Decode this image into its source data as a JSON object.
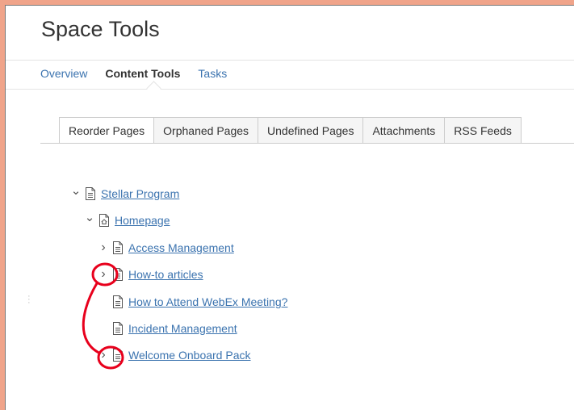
{
  "header": {
    "title": "Space Tools"
  },
  "nav": {
    "items": [
      {
        "label": "Overview",
        "active": false
      },
      {
        "label": "Content Tools",
        "active": true
      },
      {
        "label": "Tasks",
        "active": false
      }
    ]
  },
  "tabs": [
    {
      "label": "Reorder Pages",
      "active": true
    },
    {
      "label": "Orphaned Pages",
      "active": false
    },
    {
      "label": "Undefined Pages",
      "active": false
    },
    {
      "label": "Attachments",
      "active": false
    },
    {
      "label": "RSS Feeds",
      "active": false
    }
  ],
  "tree": [
    {
      "label": "Stellar Program",
      "level": 0,
      "toggle": "expanded",
      "icon": "page-icon"
    },
    {
      "label": "Homepage",
      "level": 1,
      "toggle": "expanded",
      "icon": "home-page-icon"
    },
    {
      "label": "Access Management",
      "level": 2,
      "toggle": "collapsed",
      "icon": "page-icon"
    },
    {
      "label": "How-to articles",
      "level": 2,
      "toggle": "collapsed",
      "icon": "page-icon"
    },
    {
      "label": "How to Attend WebEx Meeting?",
      "level": 2,
      "toggle": "none",
      "icon": "page-icon"
    },
    {
      "label": "Incident Management",
      "level": 2,
      "toggle": "none",
      "icon": "page-icon"
    },
    {
      "label": "Welcome Onboard Pack",
      "level": 2,
      "toggle": "collapsed",
      "icon": "page-icon"
    }
  ],
  "colors": {
    "link": "#3b73af",
    "annotation": "#e8001c",
    "background": "#f0a48a"
  }
}
